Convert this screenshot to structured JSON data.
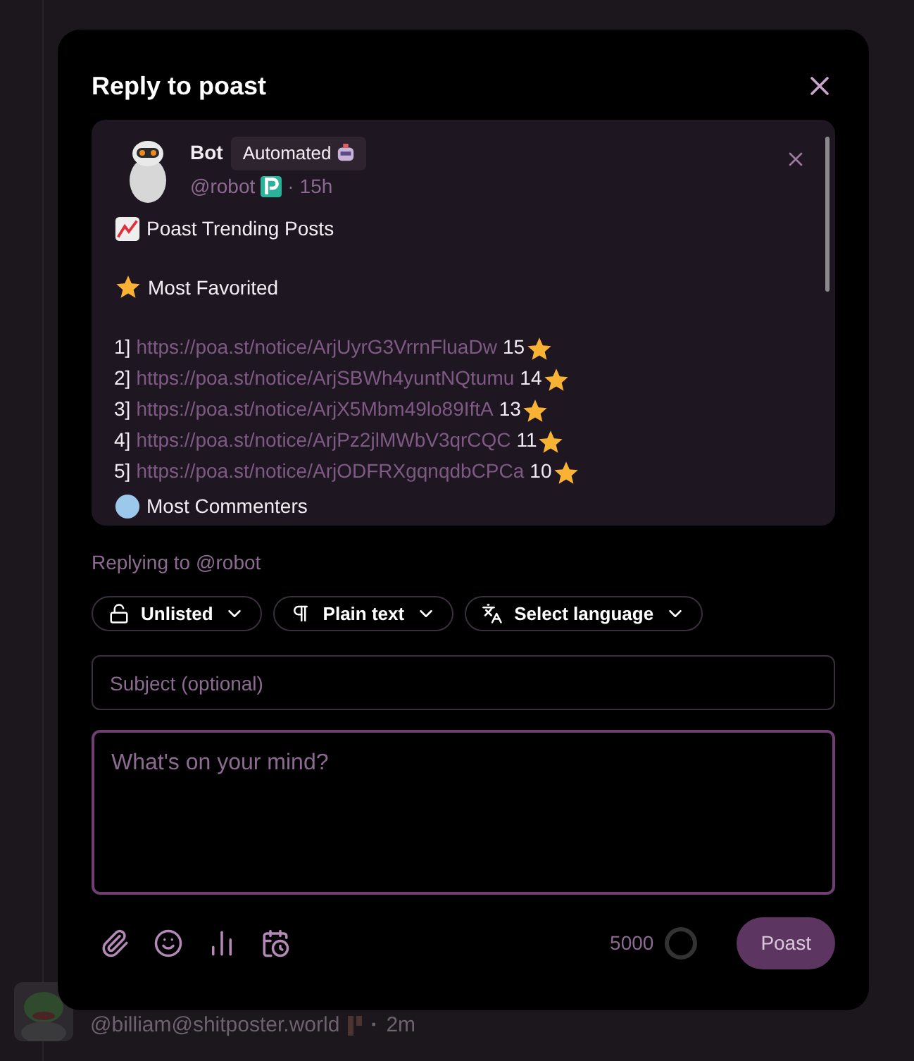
{
  "background_post": {
    "handle": "@billiam@shitposter.world",
    "separator": "·",
    "time": "2m"
  },
  "dialog": {
    "title": "Reply to poast"
  },
  "quoted_post": {
    "author": "Bot",
    "badge": "Automated",
    "handle": "@robot",
    "separator": "·",
    "time": "15h",
    "lines": [
      {
        "kind": "trending_title",
        "text": "Poast Trending Posts"
      },
      {
        "kind": "favorites_section",
        "text": "Most Favorited"
      },
      {
        "kind": "ranked_link",
        "rank": "1]",
        "url": "https://poa.st/notice/ArjUyrG3VrrnFluaDw",
        "count": "15"
      },
      {
        "kind": "ranked_link",
        "rank": "2]",
        "url": "https://poa.st/notice/ArjSBWh4yuntNQtumu",
        "count": "14"
      },
      {
        "kind": "ranked_link",
        "rank": "3]",
        "url": "https://poa.st/notice/ArjX5Mbm49lo89IftA",
        "count": "13"
      },
      {
        "kind": "ranked_link",
        "rank": "4]",
        "url": "https://poa.st/notice/ArjPz2jlMWbV3qrCQC",
        "count": "11"
      },
      {
        "kind": "ranked_link",
        "rank": "5]",
        "url": "https://poa.st/notice/ArjODFRXgqnqdbCPCa",
        "count": "10"
      },
      {
        "kind": "commenters_section",
        "text": "Most Commenters"
      }
    ]
  },
  "replying_to": {
    "label": "Replying to",
    "handle": "@robot"
  },
  "options": [
    {
      "kind": "visibility",
      "label": "Unlisted"
    },
    {
      "kind": "format",
      "label": "Plain text"
    },
    {
      "kind": "language",
      "label": "Select language"
    }
  ],
  "subject": {
    "placeholder": "Subject (optional)"
  },
  "body": {
    "placeholder": "What's on your mind?"
  },
  "char_count": "5000",
  "submit": "Poast"
}
